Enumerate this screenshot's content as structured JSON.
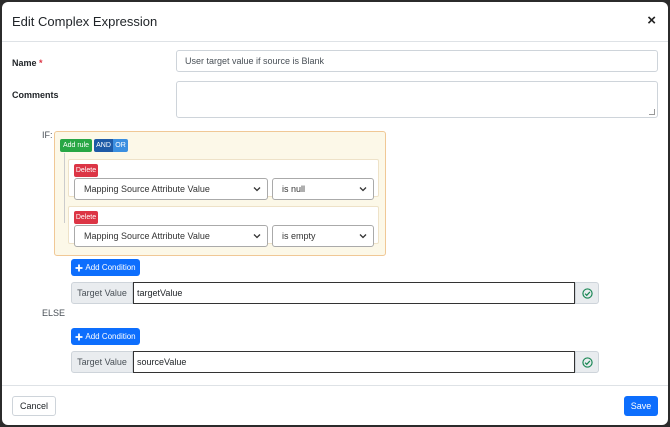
{
  "dialog": {
    "title": "Edit Complex Expression",
    "close_glyph": "×",
    "close_icon": "close-icon"
  },
  "form": {
    "name_label": "Name",
    "required_mark": "*",
    "name_value": "User target value if source is Blank",
    "comments_label": "Comments",
    "comments_value": ""
  },
  "if_block": {
    "label": "IF:",
    "add_rule_label": "Add rule",
    "and_label": "AND",
    "or_label": "OR",
    "active_condition": "AND",
    "rules": [
      {
        "delete_label": "Delete",
        "field": "Mapping Source Attribute Value",
        "operator": "is null"
      },
      {
        "delete_label": "Delete",
        "field": "Mapping Source Attribute Value",
        "operator": "is empty"
      }
    ],
    "add_condition_label": "Add Condition",
    "add_condition_icon": "plus-icon",
    "target_prefix": "Target Value",
    "target_value": "targetValue",
    "valid_icon": "check-circle-icon"
  },
  "else_block": {
    "label": "ELSE",
    "add_condition_label": "Add Condition",
    "target_prefix": "Target Value",
    "target_value": "sourceValue",
    "valid_icon": "check-circle-icon"
  },
  "footer": {
    "cancel_label": "Cancel",
    "save_label": "Save"
  },
  "colors": {
    "primary": "#0d6efd",
    "success": "#28a745",
    "danger": "#dc3545",
    "query_builder_bg": "#fcf8e8"
  }
}
